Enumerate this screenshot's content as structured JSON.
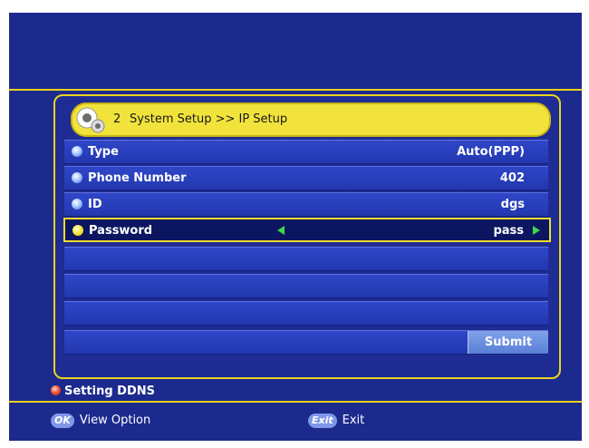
{
  "title_bar": {
    "number": "2",
    "breadcrumb": "System Setup >> IP Setup"
  },
  "rows": [
    {
      "label": "Type",
      "value": "Auto(PPP)"
    },
    {
      "label": "Phone Number",
      "value": "402"
    },
    {
      "label": "ID",
      "value": "dgs"
    },
    {
      "label": "Password",
      "value": "pass"
    }
  ],
  "submit_label": "Submit",
  "ddns_label": "Setting DDNS",
  "footer": {
    "ok_badge": "OK",
    "ok_label": "View Option",
    "exit_badge": "Exit",
    "exit_label": "Exit"
  },
  "colors": {
    "background": "#1c2a8e",
    "accent": "#f1e33c",
    "selected_row": "#0c1660",
    "arrow": "#3cd84a"
  },
  "icons": [
    "gear-icon",
    "bullet-icon",
    "arrow-left-icon",
    "arrow-right-icon",
    "red-button-icon"
  ]
}
